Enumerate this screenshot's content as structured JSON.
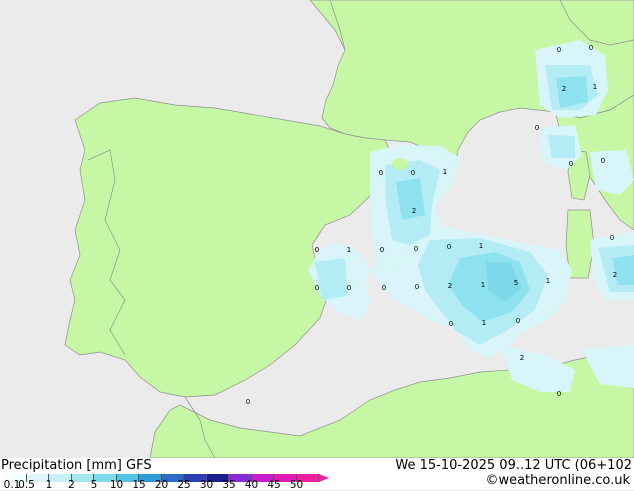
{
  "footer": {
    "title": "Precipitation [mm] GFS",
    "datetime": "We 15-10-2025 09..12 UTC (06+102",
    "credit": "©weatheronline.co.uk"
  },
  "legend": {
    "ticks": [
      "0.1",
      "0.5",
      "1",
      "2",
      "5",
      "10",
      "15",
      "20",
      "25",
      "30",
      "35",
      "40",
      "45",
      "50"
    ],
    "colors": [
      "#f4fdff",
      "#dff7fb",
      "#c4f0f6",
      "#a6e8f2",
      "#7fdbec",
      "#4fc4e4",
      "#2f9bd8",
      "#2b6cc8",
      "#2a3fb8",
      "#1a1f8c",
      "#8a2bd4",
      "#c51fd0",
      "#e21ab8",
      "#f01fa0"
    ]
  },
  "map": {
    "colors": {
      "sea": "#ebebeb",
      "land": "#c6f7a5",
      "border": "#909090"
    },
    "labels": [
      "0",
      "0",
      "1",
      "2",
      "0",
      "1",
      "0",
      "0",
      "0",
      "1",
      "0",
      "0",
      "0",
      "2",
      "1",
      "5",
      "1",
      "0",
      "1",
      "0",
      "0",
      "0",
      "0",
      "2",
      "1",
      "0",
      "0",
      "2",
      "0",
      "0",
      "2",
      "0",
      "0"
    ]
  }
}
